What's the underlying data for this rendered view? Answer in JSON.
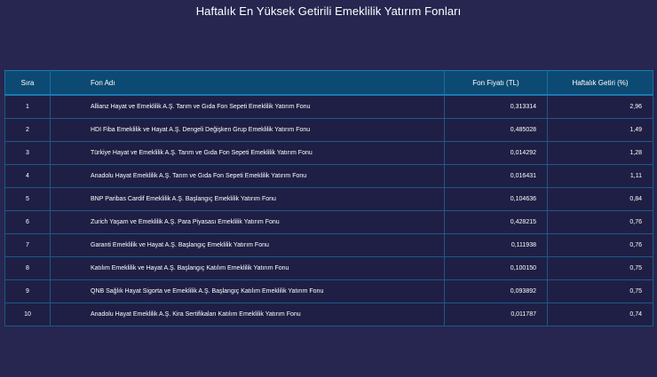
{
  "title": "Haftalık En Yüksek Getirili Emeklilik Yatırım Fonları",
  "table": {
    "headers": {
      "rank": "Sıra",
      "name": "Fon Adı",
      "price": "Fon Fiyatı (TL)",
      "return": "Haftalık Getiri (%)"
    },
    "rows": [
      {
        "rank": "1",
        "name": "Allianz Hayat ve Emeklilik A.Ş. Tarım ve Gıda Fon Sepeti Emeklilik Yatırım Fonu",
        "price": "0,313314",
        "return": "2,96"
      },
      {
        "rank": "2",
        "name": "HDI Fiba Emeklilik ve Hayat A.Ş. Dengeli Değişken Grup Emeklilik Yatırım Fonu",
        "price": "0,485028",
        "return": "1,49"
      },
      {
        "rank": "3",
        "name": "Türkiye Hayat ve Emeklilik A.Ş. Tarım ve Gıda Fon Sepeti Emeklilik Yatırım Fonu",
        "price": "0,014292",
        "return": "1,28"
      },
      {
        "rank": "4",
        "name": "Anadolu Hayat Emeklilik A.Ş. Tarım ve Gıda Fon Sepeti Emeklilik Yatırım Fonu",
        "price": "0,016431",
        "return": "1,11"
      },
      {
        "rank": "5",
        "name": "BNP Paribas Cardif Emeklilik A.Ş. Başlangıç Emeklilik Yatırım Fonu",
        "price": "0,104636",
        "return": "0,84"
      },
      {
        "rank": "6",
        "name": "Zurich Yaşam ve Emeklilik A.Ş. Para Piyasası Emeklilik Yatırım Fonu",
        "price": "0,428215",
        "return": "0,76"
      },
      {
        "rank": "7",
        "name": "Garanti Emeklilik ve Hayat A.Ş. Başlangıç Emeklilik Yatırım Fonu",
        "price": "0,111938",
        "return": "0,76"
      },
      {
        "rank": "8",
        "name": "Katılım Emeklilik ve Hayat A.Ş. Başlangıç Katılım Emeklilik Yatırım Fonu",
        "price": "0,100150",
        "return": "0,75"
      },
      {
        "rank": "9",
        "name": "QNB Sağlık Hayat Sigorta ve Emeklilik A.Ş. Başlangıç Katılım Emeklilik Yatırım Fonu",
        "price": "0,093892",
        "return": "0,75"
      },
      {
        "rank": "10",
        "name": "Anadolu Hayat Emeklilik A.Ş. Kira Sertifikaları Katılım Emeklilik Yatırım Fonu",
        "price": "0,011787",
        "return": "0,74"
      }
    ]
  },
  "colors": {
    "background": "#262650",
    "header": "#0c4a73",
    "row": "#1f1f45",
    "border": "#1e5886"
  }
}
